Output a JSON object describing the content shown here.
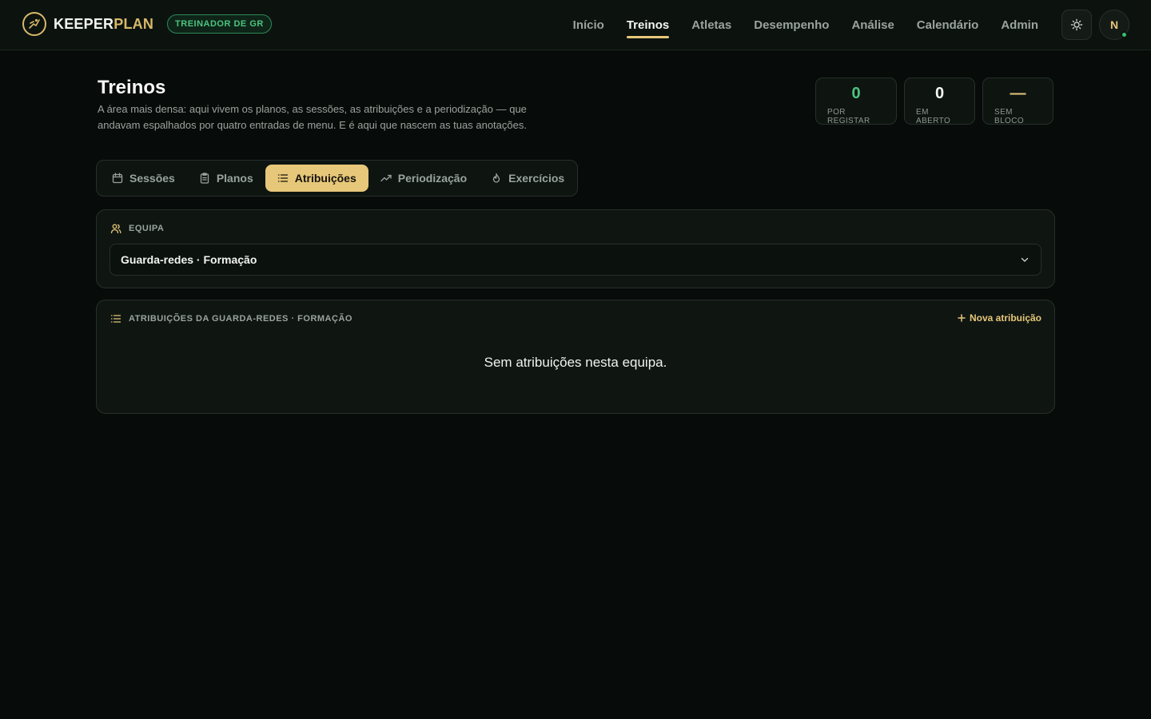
{
  "brand": {
    "name_part1": "KEEPER",
    "name_part2": "PLAN",
    "role_badge": "TREINADOR DE GR"
  },
  "nav": {
    "items": [
      {
        "label": "Início",
        "active": false
      },
      {
        "label": "Treinos",
        "active": true
      },
      {
        "label": "Atletas",
        "active": false
      },
      {
        "label": "Desempenho",
        "active": false
      },
      {
        "label": "Análise",
        "active": false
      },
      {
        "label": "Calendário",
        "active": false
      },
      {
        "label": "Admin",
        "active": false
      }
    ]
  },
  "user": {
    "initial": "N",
    "status": "online"
  },
  "page": {
    "title": "Treinos",
    "description": "A área mais densa: aqui vivem os planos, as sessões, as atribuições e a periodização — que andavam espalhados por quatro entradas de menu. E é aqui que nascem as tuas anotações."
  },
  "stats": [
    {
      "value": "0",
      "label": "POR REGISTAR"
    },
    {
      "value": "0",
      "label": "EM ABERTO"
    },
    {
      "value": "—",
      "label": "SEM BLOCO"
    }
  ],
  "tabs": [
    {
      "label": "Sessões",
      "icon": "calendar-icon",
      "active": false
    },
    {
      "label": "Planos",
      "icon": "clipboard-icon",
      "active": false
    },
    {
      "label": "Atribuições",
      "icon": "list-icon",
      "active": true
    },
    {
      "label": "Periodização",
      "icon": "trending-up-icon",
      "active": false
    },
    {
      "label": "Exercícios",
      "icon": "flame-icon",
      "active": false
    }
  ],
  "team": {
    "heading": "EQUIPA",
    "selected": "Guarda-redes · Formação"
  },
  "assignments": {
    "heading": "ATRIBUIÇÕES DA GUARDA-REDES · FORMAÇÃO",
    "new_label": "Nova atribuição",
    "empty_text": "Sem atribuições nesta equipa."
  },
  "colors": {
    "accent": "#e7c779",
    "success": "#4cc47f",
    "background": "#070b09"
  }
}
